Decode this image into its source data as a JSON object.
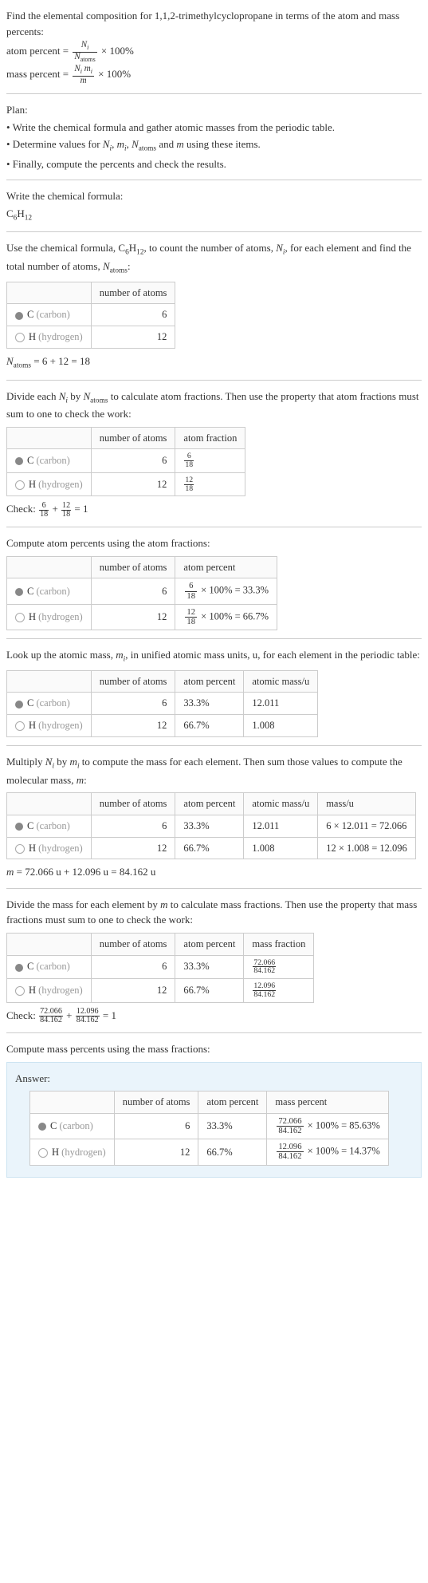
{
  "intro": {
    "line1": "Find the elemental composition for 1,1,2-trimethylcyclopropane in terms of the atom and mass percents:",
    "atom_percent_label": "atom percent = ",
    "atom_percent_frac_num": "N_i",
    "atom_percent_frac_den": "N_atoms",
    "times100": " × 100%",
    "mass_percent_label": "mass percent = ",
    "mass_percent_frac_num": "N_i m_i",
    "mass_percent_frac_den": "m"
  },
  "plan": {
    "title": "Plan:",
    "b1": "• Write the chemical formula and gather atomic masses from the periodic table.",
    "b2_a": "• Determine values for ",
    "b2_b": " using these items.",
    "b3": "• Finally, compute the percents and check the results."
  },
  "step1": {
    "text": "Write the chemical formula:",
    "formula": "C₆H₁₂"
  },
  "step2": {
    "text_a": "Use the chemical formula, C",
    "text_b": "H",
    "text_c": ", to count the number of atoms, ",
    "text_d": ", for each element and find the total number of atoms, ",
    "text_e": ":",
    "tbl": {
      "h2": "number of atoms",
      "c_label": "C ",
      "c_gray": "(carbon)",
      "c_val": "6",
      "h_label": "H ",
      "h_gray": "(hydrogen)",
      "h_val": "12"
    },
    "sum": " = 6 + 12 = 18"
  },
  "step3": {
    "text_a": "Divide each ",
    "text_b": " by ",
    "text_c": " to calculate atom fractions. Then use the property that atom fractions must sum to one to check the work:",
    "tbl": {
      "h2": "number of atoms",
      "h3": "atom fraction",
      "c_val": "6",
      "c_frac_n": "6",
      "c_frac_d": "18",
      "h_val": "12",
      "h_frac_n": "12",
      "h_frac_d": "18"
    },
    "check_label": "Check: ",
    "check_tail": " = 1"
  },
  "step4": {
    "text": "Compute atom percents using the atom fractions:",
    "tbl": {
      "h2": "number of atoms",
      "h3": "atom percent",
      "c_val": "6",
      "c_expr_n": "6",
      "c_expr_d": "18",
      "c_res": " × 100% = 33.3%",
      "h_val": "12",
      "h_expr_n": "12",
      "h_expr_d": "18",
      "h_res": " × 100% = 66.7%"
    }
  },
  "step5": {
    "text_a": "Look up the atomic mass, ",
    "text_b": ", in unified atomic mass units, u, for each element in the periodic table:",
    "tbl": {
      "h2": "number of atoms",
      "h3": "atom percent",
      "h4": "atomic mass/u",
      "c_val": "6",
      "c_pct": "33.3%",
      "c_mass": "12.011",
      "h_val": "12",
      "h_pct": "66.7%",
      "h_mass": "1.008"
    }
  },
  "step6": {
    "text_a": "Multiply ",
    "text_b": " by ",
    "text_c": " to compute the mass for each element. Then sum those values to compute the molecular mass, ",
    "text_d": ":",
    "tbl": {
      "h2": "number of atoms",
      "h3": "atom percent",
      "h4": "atomic mass/u",
      "h5": "mass/u",
      "c_val": "6",
      "c_pct": "33.3%",
      "c_mass": "12.011",
      "c_mu": "6 × 12.011 = 72.066",
      "h_val": "12",
      "h_pct": "66.7%",
      "h_mass": "1.008",
      "h_mu": "12 × 1.008 = 12.096"
    },
    "sum": " = 72.066 u + 12.096 u = 84.162 u"
  },
  "step7": {
    "text_a": "Divide the mass for each element by ",
    "text_b": " to calculate mass fractions. Then use the property that mass fractions must sum to one to check the work:",
    "tbl": {
      "h2": "number of atoms",
      "h3": "atom percent",
      "h4": "mass fraction",
      "c_val": "6",
      "c_pct": "33.3%",
      "c_frac_n": "72.066",
      "c_frac_d": "84.162",
      "h_val": "12",
      "h_pct": "66.7%",
      "h_frac_n": "12.096",
      "h_frac_d": "84.162"
    },
    "check_label": "Check: ",
    "check_tail": " = 1"
  },
  "step8": {
    "text": "Compute mass percents using the mass fractions:"
  },
  "answer": {
    "title": "Answer:",
    "tbl": {
      "h2": "number of atoms",
      "h3": "atom percent",
      "h4": "mass percent",
      "c_val": "6",
      "c_pct": "33.3%",
      "c_frac_n": "72.066",
      "c_frac_d": "84.162",
      "c_res": " × 100% = 85.63%",
      "h_val": "12",
      "h_pct": "66.7%",
      "h_frac_n": "12.096",
      "h_frac_d": "84.162",
      "h_res": " × 100% = 14.37%"
    }
  },
  "chart_data": {
    "type": "table",
    "title": "Elemental composition of 1,1,2-trimethylcyclopropane (C6H12)",
    "formula": "C6H12",
    "N_atoms": 18,
    "molecular_mass_u": 84.162,
    "elements": [
      {
        "symbol": "C",
        "name": "carbon",
        "number_of_atoms": 6,
        "atom_fraction": 0.3333,
        "atom_percent": 33.3,
        "atomic_mass_u": 12.011,
        "mass_u": 72.066,
        "mass_fraction": 0.8563,
        "mass_percent": 85.63
      },
      {
        "symbol": "H",
        "name": "hydrogen",
        "number_of_atoms": 12,
        "atom_fraction": 0.6667,
        "atom_percent": 66.7,
        "atomic_mass_u": 1.008,
        "mass_u": 12.096,
        "mass_fraction": 0.1437,
        "mass_percent": 14.37
      }
    ]
  }
}
